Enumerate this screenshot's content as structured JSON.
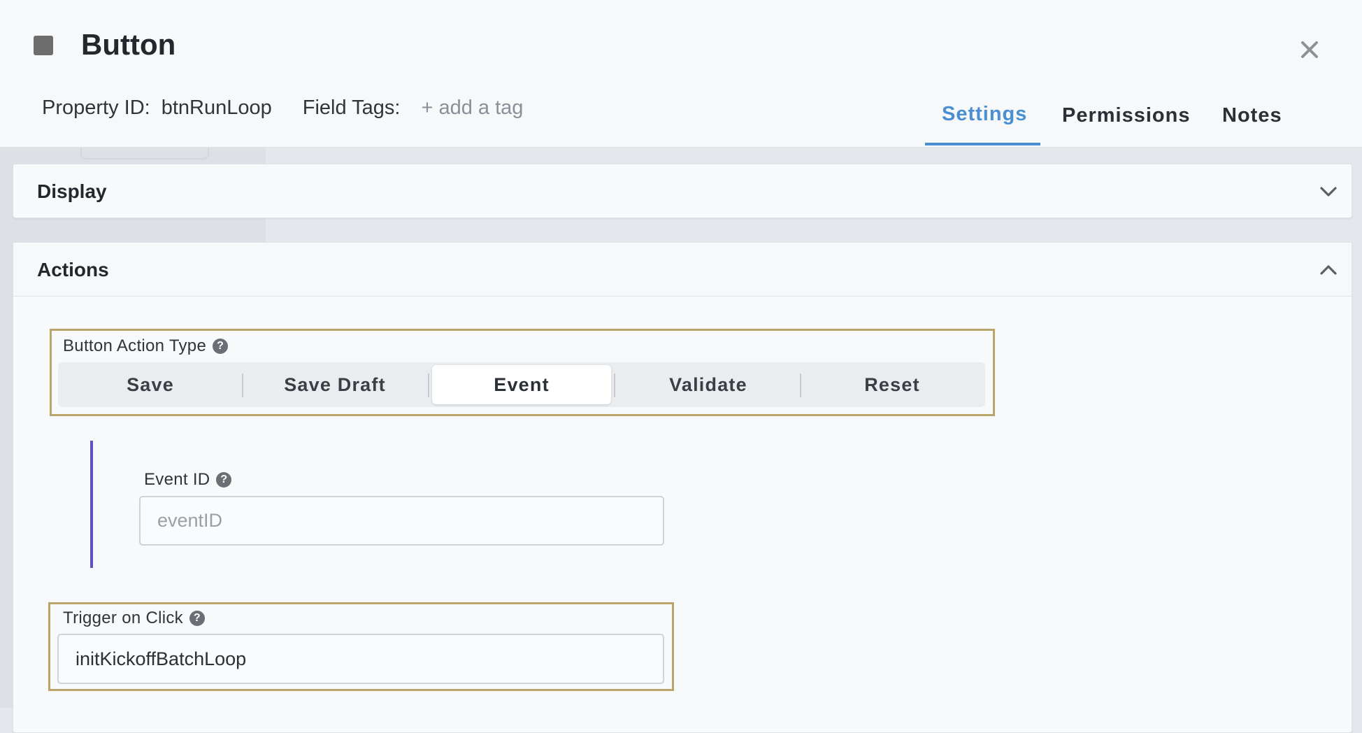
{
  "header": {
    "title": "Button",
    "property_id_label": "Property ID:",
    "property_id_value": "btnRunLoop",
    "field_tags_label": "Field Tags:",
    "add_tag_label": "+ add a tag",
    "close_icon": "close-icon"
  },
  "tabs": [
    {
      "label": "Settings",
      "active": true
    },
    {
      "label": "Permissions",
      "active": false
    },
    {
      "label": "Notes",
      "active": false
    }
  ],
  "sections": {
    "display": {
      "title": "Display",
      "expanded": false,
      "icon": "chevron-down-icon"
    },
    "actions": {
      "title": "Actions",
      "expanded": true,
      "icon": "chevron-up-icon"
    }
  },
  "button_action_type": {
    "label": "Button Action Type",
    "options": [
      "Save",
      "Save Draft",
      "Event",
      "Validate",
      "Reset"
    ],
    "selected": "Event"
  },
  "event_id": {
    "label": "Event ID",
    "value": "",
    "placeholder": "eventID"
  },
  "trigger_on_click": {
    "label": "Trigger on Click",
    "value": "initKickoffBatchLoop"
  },
  "colors": {
    "accent": "#4a8fd1",
    "highlight_border": "#b9a46a",
    "event_bar": "#6150c9"
  }
}
